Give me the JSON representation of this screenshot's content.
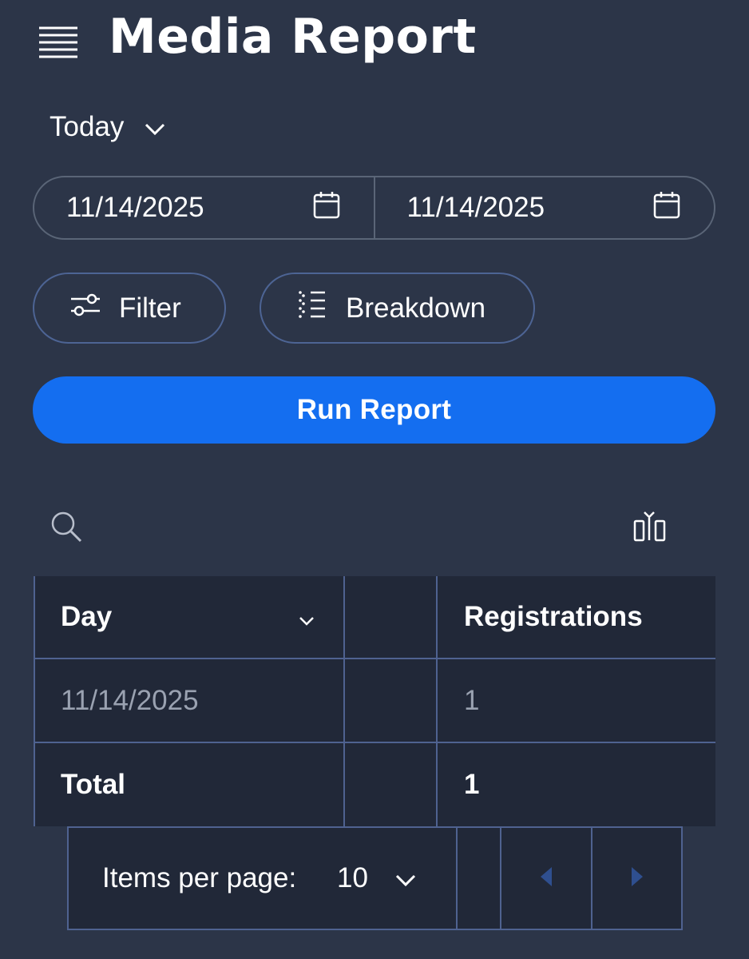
{
  "header": {
    "title": "Media Report",
    "menu_icon": "hamburger-menu-icon"
  },
  "period": {
    "selected": "Today",
    "icon": "chevron-down-icon"
  },
  "date_range": {
    "start": "11/14/2025",
    "end": "11/14/2025",
    "icon": "calendar-icon"
  },
  "actions": {
    "filter_label": "Filter",
    "filter_icon": "sliders-icon",
    "breakdown_label": "Breakdown",
    "breakdown_icon": "list-icon",
    "run_label": "Run Report",
    "run_color": "#146ef0"
  },
  "toolbar": {
    "search_icon": "search-icon",
    "columns_icon": "columns-icon"
  },
  "table": {
    "headers": [
      "Day",
      "",
      "Registrations"
    ],
    "sort_icon": "chevron-down-icon",
    "rows": [
      [
        "11/14/2025",
        "",
        "1"
      ]
    ],
    "total": [
      "Total",
      "",
      "1"
    ]
  },
  "pagination": {
    "items_per_page_label": "Items per page:",
    "items_per_page_value": "10",
    "prev_icon": "caret-left-icon",
    "next_icon": "caret-right-icon"
  },
  "colors": {
    "background": "#2c3548",
    "table_background": "#212838",
    "border": "#4f6290",
    "accent": "#146ef0"
  }
}
